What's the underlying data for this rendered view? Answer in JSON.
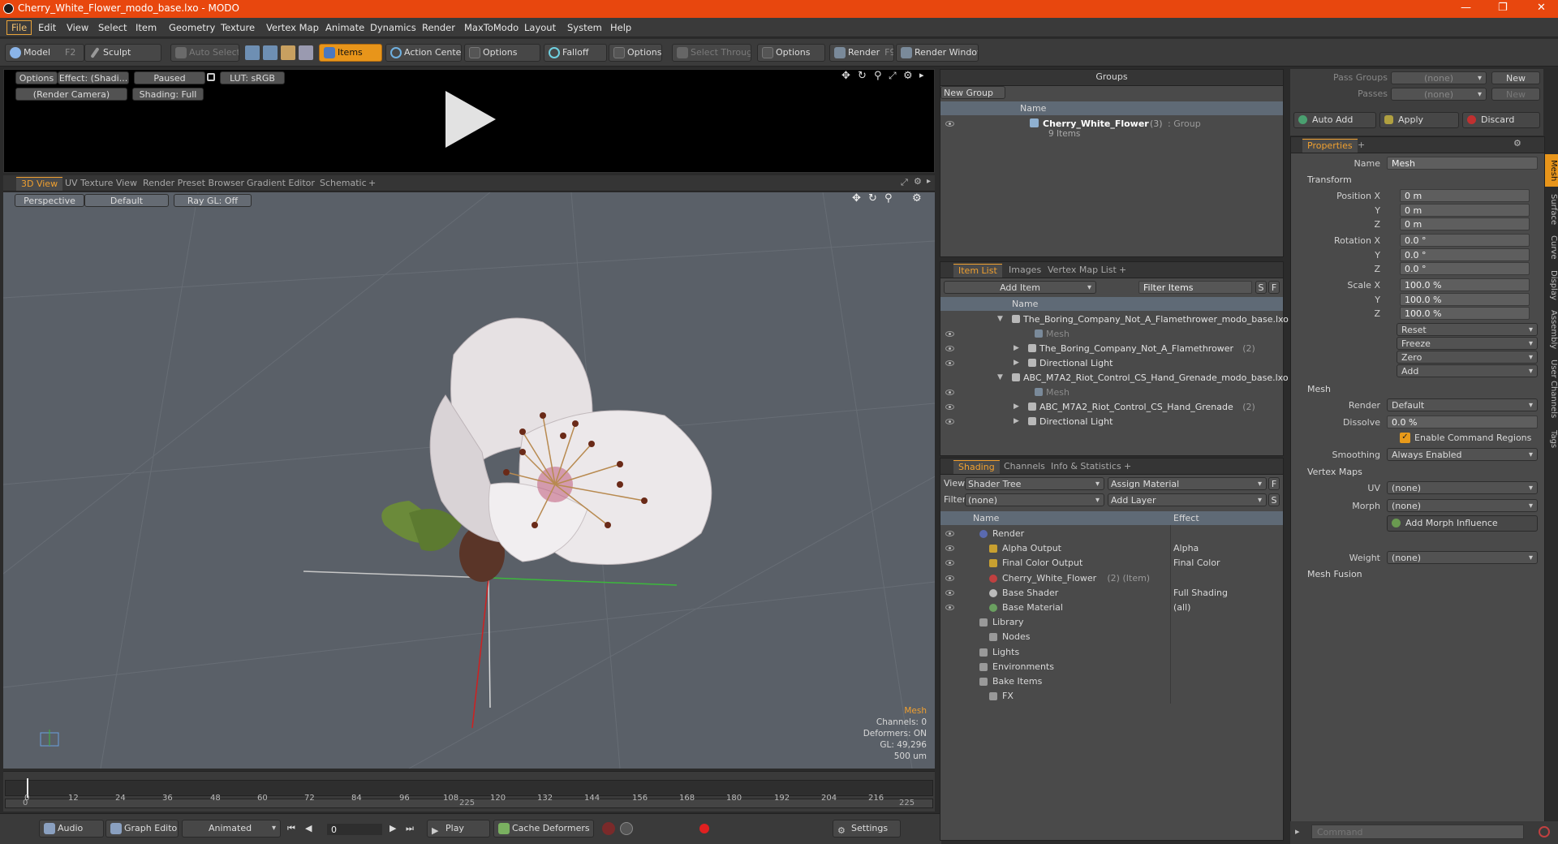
{
  "window": {
    "title": "Cherry_White_Flower_modo_base.lxo - MODO"
  },
  "menu": [
    "File",
    "Edit",
    "View",
    "Select",
    "Item",
    "Geometry",
    "Texture",
    "Vertex Map",
    "Animate",
    "Dynamics",
    "Render",
    "MaxToModo",
    "Layout",
    "System",
    "Help"
  ],
  "toolbar": {
    "model": "Model",
    "model_key": "F2",
    "sculpt": "Sculpt",
    "auto_select": "Auto Select",
    "items": "Items",
    "action_center": "Action Center",
    "options1": "Options",
    "falloff": "Falloff",
    "options2": "Options",
    "select_through": "Select Through",
    "options3": "Options",
    "render": "Render",
    "render_key": "F9",
    "render_window": "Render Window"
  },
  "preview": {
    "options": "Options",
    "effect": "Effect: (Shadi...",
    "paused": "Paused",
    "lut": "LUT: sRGB",
    "camera": "(Render Camera)",
    "shading": "Shading: Full"
  },
  "viewport_tabs": [
    "3D View",
    "UV Texture View",
    "Render Preset Browser",
    "Gradient Editor",
    "Schematic",
    "+"
  ],
  "viewport": {
    "perspective": "Perspective",
    "default": "Default",
    "raygl": "Ray GL: Off",
    "info": {
      "mesh": "Mesh",
      "channels": "Channels: 0",
      "deformers": "Deformers: ON",
      "gl": "GL: 49,296",
      "scale": "500 um"
    }
  },
  "timeline": {
    "ticks": [
      "0",
      "12",
      "24",
      "36",
      "48",
      "60",
      "72",
      "84",
      "96",
      "108",
      "120",
      "132",
      "144",
      "156",
      "168",
      "180",
      "192",
      "204",
      "216"
    ],
    "lower_left": "0",
    "lower_mid": "225",
    "lower_right": "225"
  },
  "bottombar": {
    "audio": "Audio",
    "graph_editor": "Graph Editor",
    "animated": "Animated",
    "frame": "0",
    "play": "Play",
    "cache": "Cache Deformers",
    "settings": "Settings"
  },
  "groups": {
    "title": "Groups",
    "new_group": "New Group",
    "col_name": "Name",
    "item_name": "Cherry_White_Flower",
    "item_count": "(3)",
    "item_type": ": Group",
    "item_sub": "9 Items"
  },
  "item_list": {
    "tabs": [
      "Item List",
      "Images",
      "Vertex Map List",
      "+"
    ],
    "add_item": "Add Item",
    "filter": "Filter Items",
    "s": "S",
    "f": "F",
    "col_name": "Name",
    "rows": [
      {
        "text": "The_Boring_Company_Not_A_Flamethrower_modo_base.lxo",
        "indent": 0,
        "dim": false
      },
      {
        "text": "Mesh",
        "indent": 2,
        "dim": true
      },
      {
        "text": "The_Boring_Company_Not_A_Flamethrower",
        "extra": "(2)",
        "indent": 1,
        "dim": false
      },
      {
        "text": "Directional Light",
        "indent": 1,
        "dim": false
      },
      {
        "text": "ABC_M7A2_Riot_Control_CS_Hand_Grenade_modo_base.lxo",
        "indent": 0,
        "dim": false
      },
      {
        "text": "Mesh",
        "indent": 2,
        "dim": true
      },
      {
        "text": "ABC_M7A2_Riot_Control_CS_Hand_Grenade",
        "extra": "(2)",
        "indent": 1,
        "dim": false
      },
      {
        "text": "Directional Light",
        "indent": 1,
        "dim": false
      }
    ]
  },
  "shading": {
    "tabs": [
      "Shading",
      "Channels",
      "Info & Statistics",
      "+"
    ],
    "view_label": "View",
    "view_value": "Shader Tree",
    "assign": "Assign Material",
    "f": "F",
    "filter_label": "Filter",
    "filter_value": "(none)",
    "add_layer": "Add Layer",
    "s": "S",
    "col_name": "Name",
    "col_effect": "Effect",
    "rows": [
      {
        "name": "Render",
        "effect": "",
        "indent": 0
      },
      {
        "name": "Alpha Output",
        "effect": "Alpha",
        "indent": 1
      },
      {
        "name": "Final Color Output",
        "effect": "Final Color",
        "indent": 1
      },
      {
        "name": "Cherry_White_Flower",
        "extra": "(2) (Item)",
        "effect": "",
        "indent": 1
      },
      {
        "name": "Base Shader",
        "effect": "Full Shading",
        "indent": 1
      },
      {
        "name": "Base Material",
        "effect": "(all)",
        "indent": 1
      },
      {
        "name": "Library",
        "effect": "",
        "indent": 0
      },
      {
        "name": "Nodes",
        "effect": "",
        "indent": 1
      },
      {
        "name": "Lights",
        "effect": "",
        "indent": 0
      },
      {
        "name": "Environments",
        "effect": "",
        "indent": 0
      },
      {
        "name": "Bake Items",
        "effect": "",
        "indent": 0
      },
      {
        "name": "FX",
        "effect": "",
        "indent": 1
      }
    ]
  },
  "passes": {
    "pass_groups": "Pass Groups",
    "passes": "Passes",
    "none": "(none)",
    "new": "New",
    "auto_add": "Auto Add",
    "apply": "Apply",
    "discard": "Discard"
  },
  "properties": {
    "tab": "Properties",
    "plus": "+",
    "name_label": "Name",
    "name_value": "Mesh",
    "transform": "Transform",
    "position_label": "Position X",
    "position": [
      "0 m",
      "0 m",
      "0 m"
    ],
    "rotation_label": "Rotation X",
    "rotation": [
      "0.0 °",
      "0.0 °",
      "0.0 °"
    ],
    "scale_label": "Scale X",
    "scale": [
      "100.0 %",
      "100.0 %",
      "100.0 %"
    ],
    "axis_y": "Y",
    "axis_z": "Z",
    "buttons": [
      "Reset",
      "Freeze",
      "Zero",
      "Add"
    ],
    "mesh": "Mesh",
    "render_label": "Render",
    "render_value": "Default",
    "dissolve_label": "Dissolve",
    "dissolve_value": "0.0 %",
    "enable_cmd": "Enable Command Regions",
    "smoothing_label": "Smoothing",
    "smoothing_value": "Always Enabled",
    "vertex_maps": "Vertex Maps",
    "uv_label": "UV",
    "uv_value": "(none)",
    "morph_label": "Morph",
    "morph_value": "(none)",
    "add_morph": "Add Morph Influence",
    "weight_label": "Weight",
    "weight_value": "(none)",
    "mesh_fusion": "Mesh Fusion",
    "side_tabs": [
      "Mesh",
      "Surface",
      "Curve",
      "Display",
      "Assembly",
      "User Channels",
      "Tags"
    ]
  },
  "command": {
    "placeholder": "Command"
  }
}
